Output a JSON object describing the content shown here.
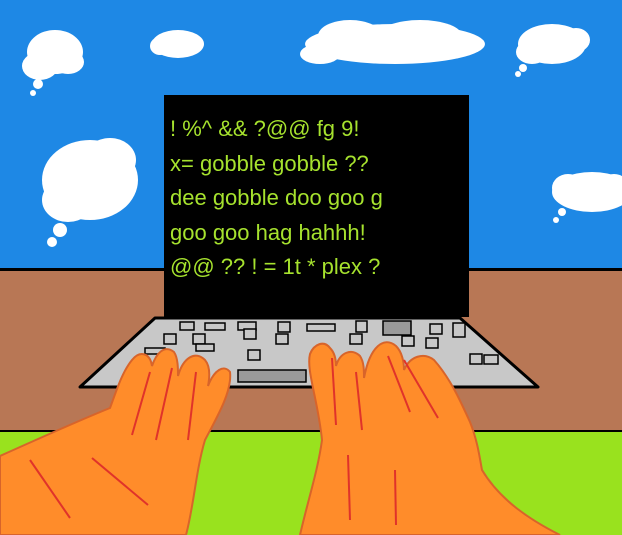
{
  "screen": {
    "lines": [
      "! %^ && ?@@ fg 9!",
      "x= gobble gobble ??",
      "dee gobble doo goo g",
      "goo goo hag hahhh!",
      "@@ ?? ! = 1t * plex ?"
    ]
  },
  "colors": {
    "sky": "#1e88e5",
    "ground": "#b87755",
    "grass": "#99e21e",
    "laptop_screen": "#000000",
    "screen_text": "#a6e22e",
    "keyboard": "#c8c8c8",
    "hands": "#ff8c2a",
    "hand_lines": "#e0332a"
  }
}
